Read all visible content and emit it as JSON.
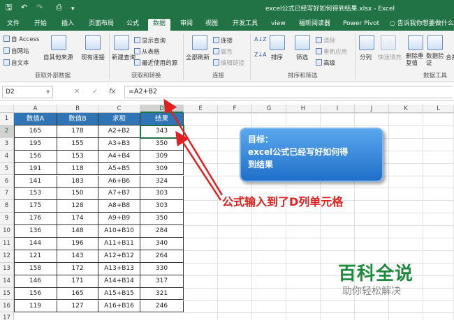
{
  "window": {
    "title": "excel公式已经写好如何得到结果.xlsx - Excel"
  },
  "quick_access": {
    "save_icon": "save-icon",
    "undo_icon": "undo-icon",
    "redo_icon": "redo-icon",
    "preview_icon": "print-preview-icon",
    "more": "▾"
  },
  "tabs": [
    "文件",
    "开始",
    "插入",
    "页面布局",
    "公式",
    "数据",
    "审阅",
    "视图",
    "开发工具",
    "view",
    "福昕阅读器",
    "Power Pivot",
    "告诉我你想要做什么"
  ],
  "active_tab": "数据",
  "ribbon": {
    "groups": [
      {
        "label": "获取外部数据",
        "items": [
          "自 Access",
          "自网站",
          "自文本",
          "自其他来源",
          "现有连接"
        ]
      },
      {
        "label": "获取和转换",
        "items": [
          "新建查询",
          "显示查询",
          "从表格",
          "最近使用的源"
        ]
      },
      {
        "label": "连接",
        "items": [
          "全部刷新",
          "连接",
          "属性",
          "编辑链接"
        ]
      },
      {
        "label": "排序和筛选",
        "items": [
          "排序",
          "筛选",
          "清除",
          "重新应用",
          "高级"
        ]
      },
      {
        "label": "数据工具",
        "items": [
          "分列",
          "快速填充",
          "删除重复值",
          "数据验证",
          "合并"
        ]
      }
    ]
  },
  "formula_bar": {
    "name_box": "D2",
    "cancel": "✕",
    "enter": "✓",
    "fx": "fx",
    "formula": "=A2+B2"
  },
  "columns": [
    "A",
    "B",
    "C",
    "D",
    "E",
    "F",
    "G",
    "H",
    "I",
    "J",
    "K",
    "L"
  ],
  "selected_cell": "D2",
  "table": {
    "headers": [
      "数值A",
      "数值B",
      "求和",
      "结果"
    ],
    "rows": [
      [
        "165",
        "178",
        "A2+B2",
        "343"
      ],
      [
        "195",
        "155",
        "A3+B3",
        "350"
      ],
      [
        "156",
        "153",
        "A4+B4",
        "309"
      ],
      [
        "191",
        "118",
        "A5+B5",
        "309"
      ],
      [
        "141",
        "183",
        "A6+B6",
        "324"
      ],
      [
        "153",
        "150",
        "A7+B7",
        "303"
      ],
      [
        "175",
        "128",
        "A8+B8",
        "303"
      ],
      [
        "176",
        "174",
        "A9+B9",
        "350"
      ],
      [
        "136",
        "148",
        "A10+B10",
        "284"
      ],
      [
        "144",
        "196",
        "A11+B11",
        "340"
      ],
      [
        "121",
        "143",
        "A12+B12",
        "264"
      ],
      [
        "158",
        "172",
        "A13+B13",
        "330"
      ],
      [
        "146",
        "171",
        "A14+B14",
        "317"
      ],
      [
        "156",
        "165",
        "A15+B15",
        "321"
      ],
      [
        "119",
        "127",
        "A16+B16",
        "246"
      ]
    ]
  },
  "row_numbers": [
    "1",
    "2",
    "3",
    "4",
    "5",
    "6",
    "7",
    "8",
    "9",
    "10",
    "11",
    "12",
    "13",
    "14",
    "15",
    "16",
    "17"
  ],
  "callout": {
    "line1": "目标：",
    "line2": "excel公式已经写好如何得",
    "line3": "到结果"
  },
  "annotation": "公式输入到了D列单元格",
  "watermark": {
    "title": "百科全说",
    "subtitle": "助你轻松解决"
  },
  "colors": {
    "excel_green": "#217346",
    "header_fill": "#2f75b5",
    "annotation_red": "#e02020",
    "watermark_green": "#1f8a3d"
  }
}
